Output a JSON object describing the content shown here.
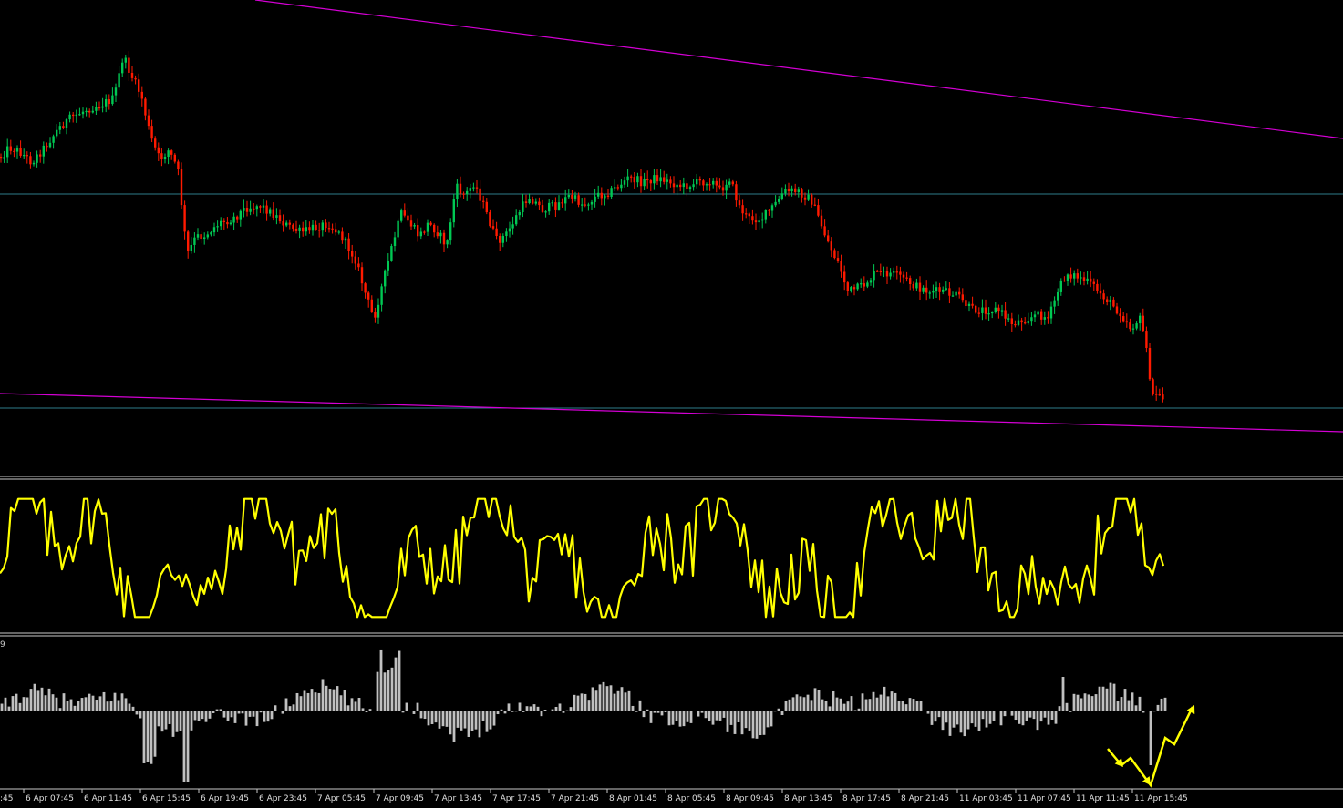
{
  "colors": {
    "background": "#000000",
    "bull_candle": "#00c853",
    "bear_candle": "#ff1a00",
    "trendline": "#d400d4",
    "support_line": "#2e7d8a",
    "oscillator": "#ffff00",
    "histogram": "#c0c0c0",
    "annotation_arrow": "#ffff00",
    "separator": "#c8c8c8"
  },
  "icons": {
    "annotation": "zigzag-arrow-icon"
  },
  "indicator_label": "9",
  "chart_data": [
    {
      "type": "candlestick",
      "panel": "price",
      "grid": false,
      "x_ticks": [
        "6 Apr 07:45",
        "6 Apr 11:45",
        "6 Apr 15:45",
        "6 Apr 19:45",
        "6 Apr 23:45",
        "7 Apr 05:45",
        "7 Apr 09:45",
        "7 Apr 13:45",
        "7 Apr 17:45",
        "7 Apr 21:45",
        "8 Apr 01:45",
        "8 Apr 05:45",
        "8 Apr 09:45",
        "8 Apr 13:45",
        "8 Apr 17:45",
        "8 Apr 21:45",
        "11 Apr 03:45",
        "11 Apr 07:45",
        "11 Apr 11:45",
        "11 Apr 15:45"
      ],
      "close_path": [
        [
          0,
          172
        ],
        [
          10,
          162
        ],
        [
          20,
          165
        ],
        [
          35,
          178
        ],
        [
          50,
          160
        ],
        [
          65,
          140
        ],
        [
          80,
          128
        ],
        [
          95,
          120
        ],
        [
          110,
          115
        ],
        [
          125,
          108
        ],
        [
          135,
          62
        ],
        [
          145,
          85
        ],
        [
          155,
          105
        ],
        [
          165,
          150
        ],
        [
          175,
          175
        ],
        [
          185,
          165
        ],
        [
          195,
          185
        ],
        [
          205,
          280
        ],
        [
          215,
          260
        ],
        [
          225,
          258
        ],
        [
          240,
          245
        ],
        [
          255,
          240
        ],
        [
          270,
          228
        ],
        [
          285,
          225
        ],
        [
          300,
          235
        ],
        [
          315,
          248
        ],
        [
          330,
          255
        ],
        [
          345,
          250
        ],
        [
          360,
          245
        ],
        [
          375,
          260
        ],
        [
          390,
          285
        ],
        [
          400,
          320
        ],
        [
          410,
          350
        ],
        [
          420,
          310
        ],
        [
          430,
          270
        ],
        [
          440,
          235
        ],
        [
          450,
          245
        ],
        [
          460,
          260
        ],
        [
          470,
          245
        ],
        [
          480,
          255
        ],
        [
          490,
          270
        ],
        [
          500,
          205
        ],
        [
          510,
          215
        ],
        [
          520,
          200
        ],
        [
          530,
          225
        ],
        [
          545,
          265
        ],
        [
          555,
          258
        ],
        [
          565,
          240
        ],
        [
          580,
          215
        ],
        [
          595,
          230
        ],
        [
          610,
          225
        ],
        [
          625,
          215
        ],
        [
          640,
          225
        ],
        [
          655,
          215
        ],
        [
          670,
          210
        ],
        [
          690,
          195
        ],
        [
          705,
          200
        ],
        [
          720,
          195
        ],
        [
          735,
          200
        ],
        [
          750,
          205
        ],
        [
          765,
          200
        ],
        [
          780,
          198
        ],
        [
          790,
          210
        ],
        [
          800,
          195
        ],
        [
          810,
          225
        ],
        [
          820,
          240
        ],
        [
          835,
          240
        ],
        [
          850,
          225
        ],
        [
          860,
          210
        ],
        [
          875,
          210
        ],
        [
          890,
          220
        ],
        [
          900,
          245
        ],
        [
          910,
          270
        ],
        [
          920,
          290
        ],
        [
          930,
          320
        ],
        [
          945,
          315
        ],
        [
          960,
          300
        ],
        [
          975,
          300
        ],
        [
          990,
          305
        ],
        [
          1005,
          315
        ],
        [
          1020,
          320
        ],
        [
          1035,
          320
        ],
        [
          1050,
          325
        ],
        [
          1065,
          340
        ],
        [
          1080,
          340
        ],
        [
          1095,
          340
        ],
        [
          1110,
          355
        ],
        [
          1125,
          350
        ],
        [
          1140,
          345
        ],
        [
          1150,
          350
        ],
        [
          1160,
          320
        ],
        [
          1170,
          300
        ],
        [
          1185,
          305
        ],
        [
          1200,
          315
        ],
        [
          1215,
          330
        ],
        [
          1230,
          345
        ],
        [
          1240,
          360
        ],
        [
          1250,
          350
        ],
        [
          1258,
          380
        ],
        [
          1262,
          435
        ],
        [
          1268,
          432
        ],
        [
          1275,
          438
        ]
      ],
      "trendlines": [
        {
          "from_x": 280,
          "from_y": 0,
          "to_x": 1473,
          "to_y": 152
        },
        {
          "from_x": 0,
          "from_y": 432,
          "to_x": 1473,
          "to_y": 474
        }
      ],
      "horizontal_lines": [
        213,
        448
      ]
    },
    {
      "type": "line",
      "panel": "oscillator",
      "grid": false
    },
    {
      "type": "bar",
      "panel": "histogram",
      "grid": false
    }
  ]
}
